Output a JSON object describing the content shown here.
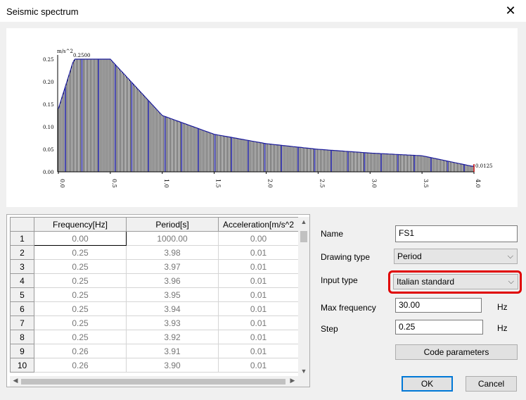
{
  "window": {
    "title": "Seismic spectrum",
    "close_glyph": "✕"
  },
  "chart_data": {
    "type": "bar",
    "ylabel": "m/s^2",
    "xlim": [
      0,
      4.0
    ],
    "ylim": [
      0,
      0.25
    ],
    "yticks": [
      "0.00",
      "0.05",
      "0.10",
      "0.15",
      "0.20",
      "0.25"
    ],
    "xticks": [
      "0.0",
      "0.5",
      "1.0",
      "1.5",
      "2.0",
      "2.5",
      "3.0",
      "3.5",
      "4.0"
    ],
    "annotations": {
      "peak": "0.2500",
      "end": "0.0125"
    },
    "series": [
      {
        "x": [
          0.0,
          0.15,
          0.5,
          1.0,
          1.5,
          2.0,
          2.5,
          3.0,
          3.5,
          3.98
        ],
        "values": [
          0.14,
          0.25,
          0.25,
          0.125,
          0.0833,
          0.0625,
          0.05,
          0.0417,
          0.0357,
          0.0125
        ]
      }
    ],
    "bar_color": "#000000",
    "accent_color": "#1a1a9a",
    "grid": false
  },
  "table": {
    "columns": [
      "Frequency[Hz]",
      "Period[s]",
      "Acceleration[m/s^2"
    ],
    "rows": [
      {
        "n": "1",
        "freq": "0.00",
        "period": "1000.00",
        "acc": "0.00"
      },
      {
        "n": "2",
        "freq": "0.25",
        "period": "3.98",
        "acc": "0.01"
      },
      {
        "n": "3",
        "freq": "0.25",
        "period": "3.97",
        "acc": "0.01"
      },
      {
        "n": "4",
        "freq": "0.25",
        "period": "3.96",
        "acc": "0.01"
      },
      {
        "n": "5",
        "freq": "0.25",
        "period": "3.95",
        "acc": "0.01"
      },
      {
        "n": "6",
        "freq": "0.25",
        "period": "3.94",
        "acc": "0.01"
      },
      {
        "n": "7",
        "freq": "0.25",
        "period": "3.93",
        "acc": "0.01"
      },
      {
        "n": "8",
        "freq": "0.25",
        "period": "3.92",
        "acc": "0.01"
      },
      {
        "n": "9",
        "freq": "0.26",
        "period": "3.91",
        "acc": "0.01"
      },
      {
        "n": "10",
        "freq": "0.26",
        "period": "3.90",
        "acc": "0.01"
      }
    ]
  },
  "form": {
    "name_label": "Name",
    "name_value": "FS1",
    "drawing_type_label": "Drawing type",
    "drawing_type_value": "Period",
    "input_type_label": "Input type",
    "input_type_value": "Italian standard",
    "max_freq_label": "Max frequency",
    "max_freq_value": "30.00",
    "max_freq_unit": "Hz",
    "step_label": "Step",
    "step_value": "0.25",
    "step_unit": "Hz",
    "code_params_label": "Code parameters",
    "ok_label": "OK",
    "cancel_label": "Cancel",
    "highlight_color": "#e00000"
  }
}
